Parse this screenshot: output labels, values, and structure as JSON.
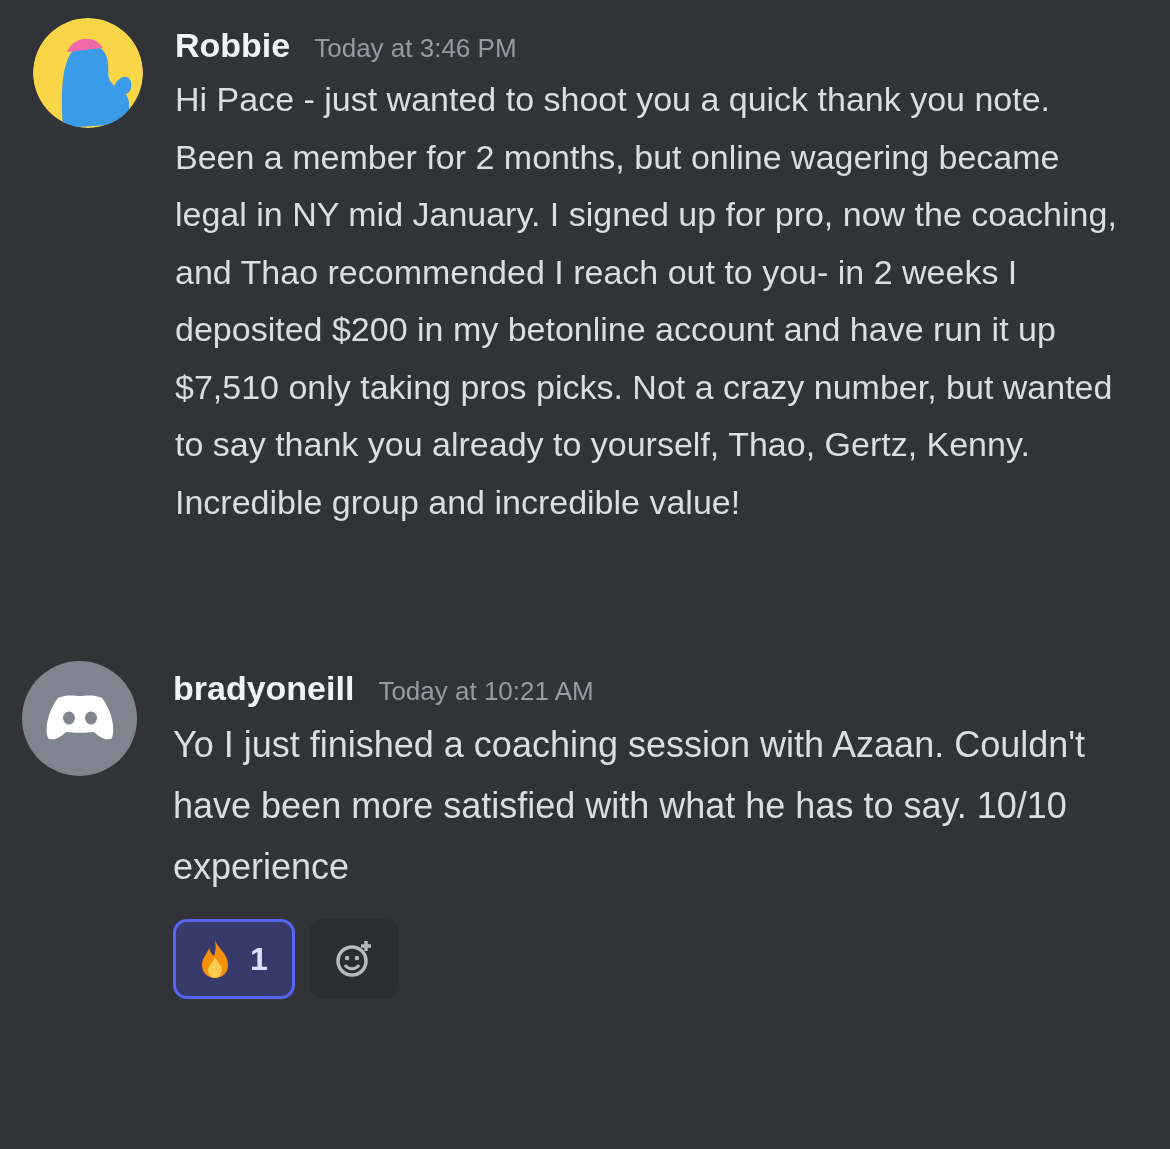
{
  "messages": [
    {
      "author": "Robbie",
      "timestamp": "Today at 3:46 PM",
      "avatar": {
        "kind": "character"
      },
      "text": "Hi Pace - just wanted to shoot you a quick thank you note. Been a member for 2 months, but online wagering became legal in NY mid January. I signed up for pro, now the coaching, and Thao recommended I reach out to you- in 2 weeks I deposited $200 in my betonline account and have run it up $7,510 only taking pros picks. Not a crazy number, but wanted to say thank you already to yourself, Thao, Gertz, Kenny. Incredible group and incredible value!"
    },
    {
      "author": "bradyoneill",
      "timestamp": "Today at 10:21 AM",
      "avatar": {
        "kind": "controller"
      },
      "text": "Yo I just finished a coaching session with Azaan. Couldn't have been more satisfied with what he has to say. 10/10 experience",
      "reactions": [
        {
          "count": "1",
          "selected": true
        }
      ]
    }
  ]
}
